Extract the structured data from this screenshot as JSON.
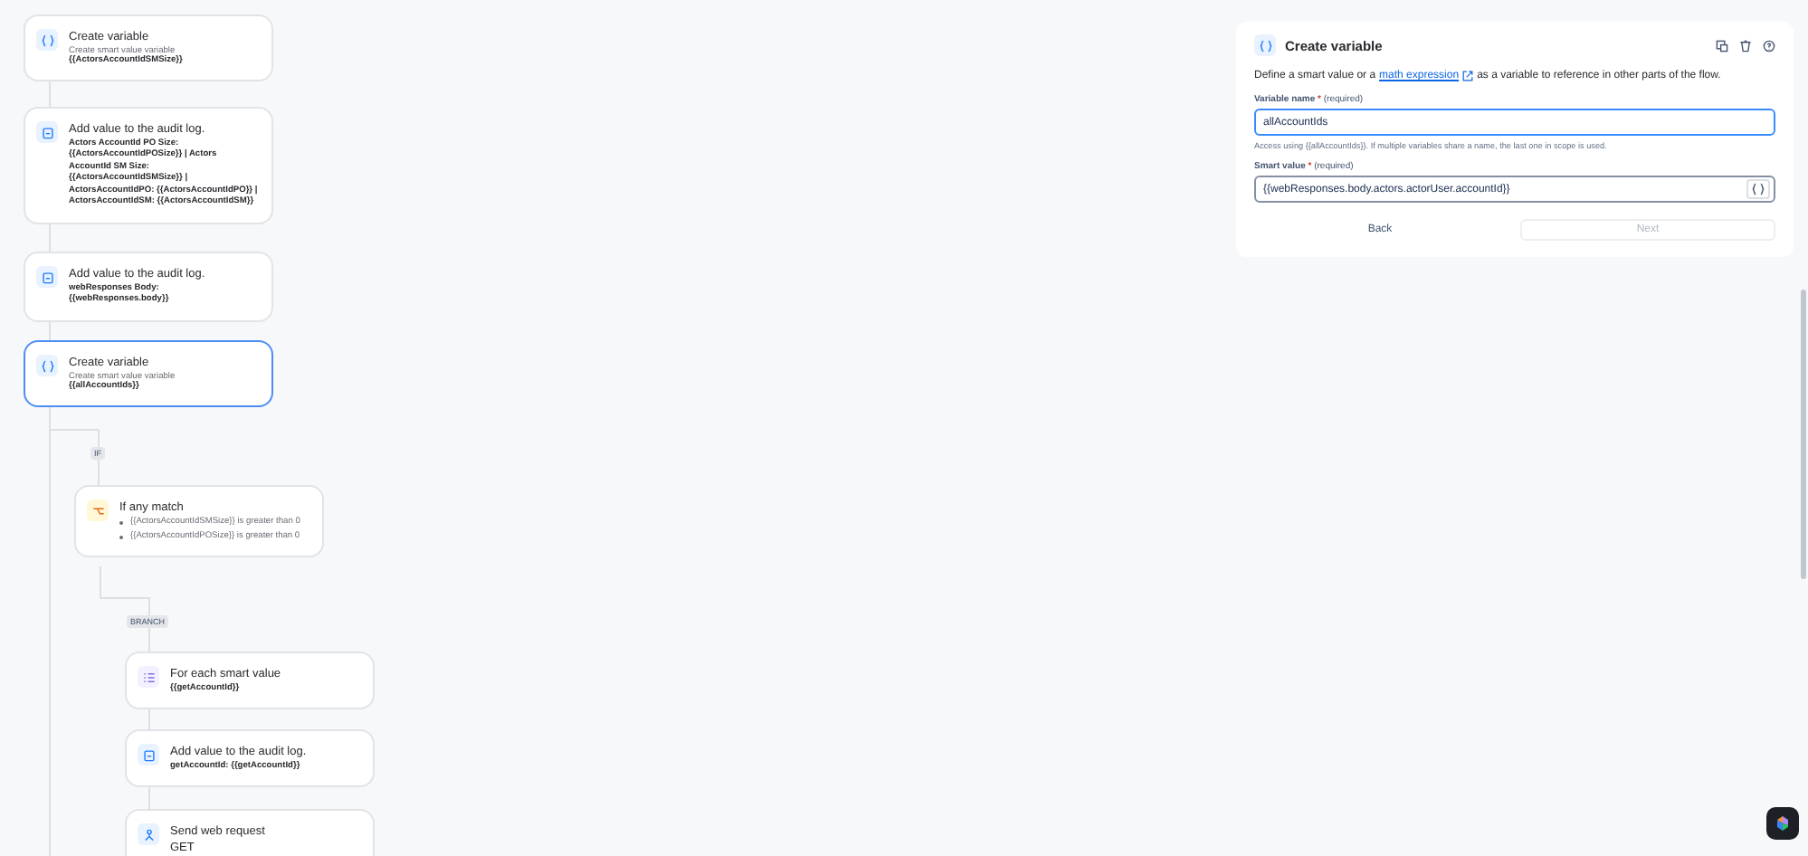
{
  "flow": {
    "nodes": [
      {
        "kind": "variable",
        "title": "Create variable",
        "subtitle": "Create smart value variable",
        "detail": "{{ActorsAccountIdSMSize}}",
        "selected": false
      },
      {
        "kind": "audit",
        "title": "Add value to the audit log.",
        "detail": "Actors AccountId PO Size: {{ActorsAccountIdPOSize}} | Actors AccountId SM Size: {{ActorsAccountIdSMSize}} | ActorsAccountIdPO: {{ActorsAccountIdPO}} | ActorsAccountIdSM: {{ActorsAccountIdSM}}",
        "selected": false
      },
      {
        "kind": "audit",
        "title": "Add value to the audit log.",
        "detail": "webResponses Body: {{webResponses.body}}",
        "selected": false
      },
      {
        "kind": "variable",
        "title": "Create variable",
        "subtitle": "Create smart value variable",
        "detail": "{{allAccountIds}}",
        "selected": true
      },
      {
        "kind": "tag",
        "label": "IF"
      },
      {
        "kind": "condition",
        "title": "If any match",
        "conditions": [
          "{{ActorsAccountIdSMSize}} is greater than 0",
          "{{ActorsAccountIdPOSize}} is greater than 0"
        ],
        "selected": false
      },
      {
        "kind": "tag",
        "label": "BRANCH"
      },
      {
        "kind": "foreach",
        "title": "For each smart value",
        "detail": "{{getAccountId}}",
        "selected": false
      },
      {
        "kind": "audit",
        "title": "Add value to the audit log.",
        "detail": "getAccountId: {{getAccountId}}",
        "selected": false
      },
      {
        "kind": "web",
        "title": "Send web request",
        "method": "GET",
        "selected": false
      }
    ]
  },
  "panel": {
    "title": "Create variable",
    "description_before": "Define a smart value or a",
    "link": "math expression",
    "description_after": "as a variable to reference in other parts of the flow.",
    "fields": [
      {
        "label": "Variable name",
        "required_mark": "*",
        "required": "(required)",
        "value": "allAccountIds",
        "focused": true,
        "help": "Access using {{allAccountIds}}. If multiple variables share a name, the last one in scope is used."
      },
      {
        "label": "Smart value",
        "required_mark": "*",
        "required": "(required)",
        "value": "{{webResponses.body.actors.actorUser.accountId}}",
        "focused": false
      }
    ],
    "buttons": [
      {
        "label": "Back",
        "disabled": false
      },
      {
        "label": "Next",
        "disabled": true
      }
    ]
  }
}
